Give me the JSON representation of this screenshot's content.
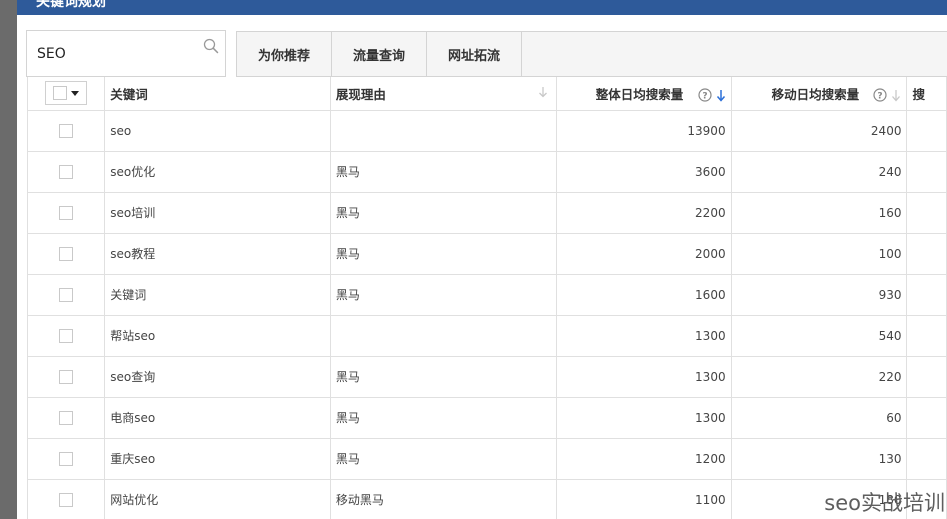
{
  "dialog": {
    "title": "关键词规划"
  },
  "search": {
    "value": "SEO",
    "icon": "search-icon"
  },
  "tabs": [
    {
      "label": "为你推荐"
    },
    {
      "label": "流量查询"
    },
    {
      "label": "网址拓流"
    }
  ],
  "table": {
    "columns": {
      "keyword": "关键词",
      "reason": "展现理由",
      "total_daily": "整体日均搜索量",
      "mobile_daily": "移动日均搜索量",
      "next": "搜"
    },
    "sort": {
      "column": "total_daily",
      "direction": "desc"
    },
    "rows": [
      {
        "keyword": "seo",
        "reason": "",
        "total": "13900",
        "mobile": "2400"
      },
      {
        "keyword": "seo优化",
        "reason": "黑马",
        "total": "3600",
        "mobile": "240"
      },
      {
        "keyword": "seo培训",
        "reason": "黑马",
        "total": "2200",
        "mobile": "160"
      },
      {
        "keyword": "seo教程",
        "reason": "黑马",
        "total": "2000",
        "mobile": "100"
      },
      {
        "keyword": "关键词",
        "reason": "黑马",
        "total": "1600",
        "mobile": "930"
      },
      {
        "keyword": "帮站seo",
        "reason": "",
        "total": "1300",
        "mobile": "540"
      },
      {
        "keyword": "seo查询",
        "reason": "黑马",
        "total": "1300",
        "mobile": "220"
      },
      {
        "keyword": "电商seo",
        "reason": "黑马",
        "total": "1300",
        "mobile": "60"
      },
      {
        "keyword": "重庆seo",
        "reason": "黑马",
        "total": "1200",
        "mobile": "130"
      },
      {
        "keyword": "网站优化",
        "reason": "移动黑马",
        "total": "1100",
        "mobile": "180"
      }
    ]
  },
  "watermark": "seo实战培训",
  "colors": {
    "titlebar": "#2e5a9a",
    "sort_active": "#2b6fd8",
    "overlay": "#6b6b6b"
  }
}
